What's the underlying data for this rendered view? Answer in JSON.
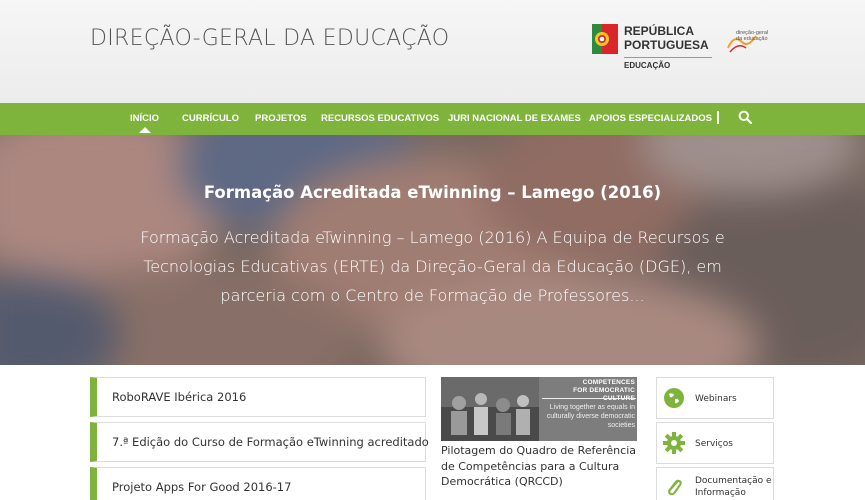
{
  "header": {
    "site_title": "DIREÇÃO-GERAL DA EDUCAÇÃO",
    "logo_line1": "REPÚBLICA",
    "logo_line2": "PORTUGUESA",
    "logo_sub": "EDUCAÇÃO",
    "dge_logo_line1": "direção-geral",
    "dge_logo_line2": "da educação"
  },
  "nav": {
    "items": [
      {
        "label": "INÍCIO"
      },
      {
        "label": "CURRÍCULO"
      },
      {
        "label": "PROJETOS"
      },
      {
        "label": "RECURSOS EDUCATIVOS"
      },
      {
        "label": "JURI NACIONAL DE EXAMES"
      },
      {
        "label": "APOIOS ESPECIALIZADOS"
      }
    ],
    "search_icon": "search-icon"
  },
  "hero": {
    "title": "Formação Acreditada eTwinning – Lamego (2016)",
    "text": "Formação Acreditada eTwinning – Lamego (2016) A Equipa de Recursos e Tecnologias Educativas (ERTE) da Direção-Geral da Educação (DGE), em parceria com o Centro de Formação de Professores..."
  },
  "news": [
    {
      "label": "RoboRAVE Ibérica 2016"
    },
    {
      "label": "7.ª Edição do Curso de Formação eTwinning acreditado"
    },
    {
      "label": "Projeto Apps For Good 2016-17"
    }
  ],
  "feature": {
    "image_caption_top_1": "COMPETENCES",
    "image_caption_top_2": "FOR DEMOCRATIC CULTURE",
    "image_caption_bottom": "Living together as equals in culturally diverse democratic societies",
    "title": "Pilotagem do Quadro de Referência de Competências para a Cultura Democrática (QRCCD)"
  },
  "quick_links": [
    {
      "label": "Webinars",
      "icon": "globe-icon"
    },
    {
      "label": "Serviços",
      "icon": "gear-icon"
    },
    {
      "label": "Documentação e Informação",
      "icon": "paperclip-icon"
    }
  ],
  "colors": {
    "accent": "#7fb43c",
    "header_bg": "#f1f1f1",
    "text": "#333333"
  }
}
